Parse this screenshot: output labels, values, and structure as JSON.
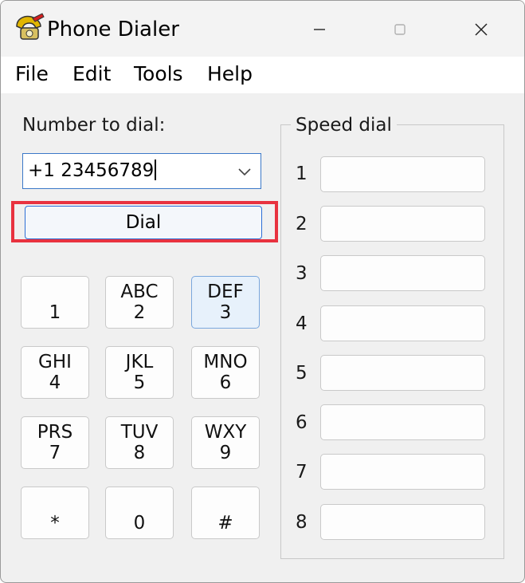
{
  "window": {
    "title": "Phone Dialer",
    "controls": {
      "minimize": "—",
      "maximize": "☐",
      "close": "✕"
    }
  },
  "menu": [
    "File",
    "Edit",
    "Tools",
    "Help"
  ],
  "dialer": {
    "number_label": "Number to dial:",
    "number_value": "+1 23456789",
    "dial_label": "Dial"
  },
  "keypad": [
    {
      "letters": "",
      "digit": "1"
    },
    {
      "letters": "ABC",
      "digit": "2"
    },
    {
      "letters": "DEF",
      "digit": "3"
    },
    {
      "letters": "GHI",
      "digit": "4"
    },
    {
      "letters": "JKL",
      "digit": "5"
    },
    {
      "letters": "MNO",
      "digit": "6"
    },
    {
      "letters": "PRS",
      "digit": "7"
    },
    {
      "letters": "TUV",
      "digit": "8"
    },
    {
      "letters": "WXY",
      "digit": "9"
    },
    {
      "letters": "",
      "digit": "*"
    },
    {
      "letters": "",
      "digit": "0"
    },
    {
      "letters": "",
      "digit": "#"
    }
  ],
  "speed_dial": {
    "title": "Speed dial",
    "slots": [
      {
        "number": "1",
        "value": ""
      },
      {
        "number": "2",
        "value": ""
      },
      {
        "number": "3",
        "value": ""
      },
      {
        "number": "4",
        "value": ""
      },
      {
        "number": "5",
        "value": ""
      },
      {
        "number": "6",
        "value": ""
      },
      {
        "number": "7",
        "value": ""
      },
      {
        "number": "8",
        "value": ""
      }
    ]
  },
  "colors": {
    "highlight": "#e8323f",
    "focus": "#2e6fd6"
  }
}
